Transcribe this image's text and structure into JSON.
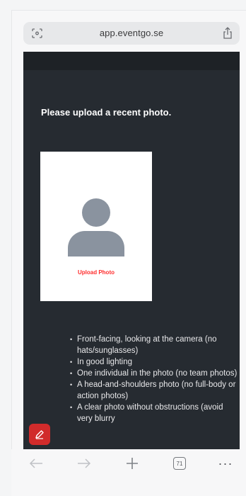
{
  "browser": {
    "address": "app.eventgo.se",
    "tab_count": "71"
  },
  "page": {
    "title": "Please upload a recent photo.",
    "upload_label": "Upload Photo",
    "guidelines": [
      "Front-facing, looking at the camera (no hats/sunglasses)",
      "In good lighting",
      "One individual in the photo (no team photos)",
      "A head-and-shoulders photo (no full-body or action photos)",
      "A clear photo without obstructions (avoid very blurry"
    ]
  },
  "colors": {
    "page_background": "#262b31",
    "upload_accent": "#ff2d2d",
    "fab": "#d12b2b"
  },
  "icons": {
    "reader": "reader-mode-icon",
    "share": "share-icon",
    "avatar": "person-silhouette-icon",
    "fab": "pencil-icon",
    "back": "arrow-left-icon",
    "forward": "arrow-right-icon",
    "new_tab": "plus-icon",
    "more": "more-dots-icon"
  }
}
